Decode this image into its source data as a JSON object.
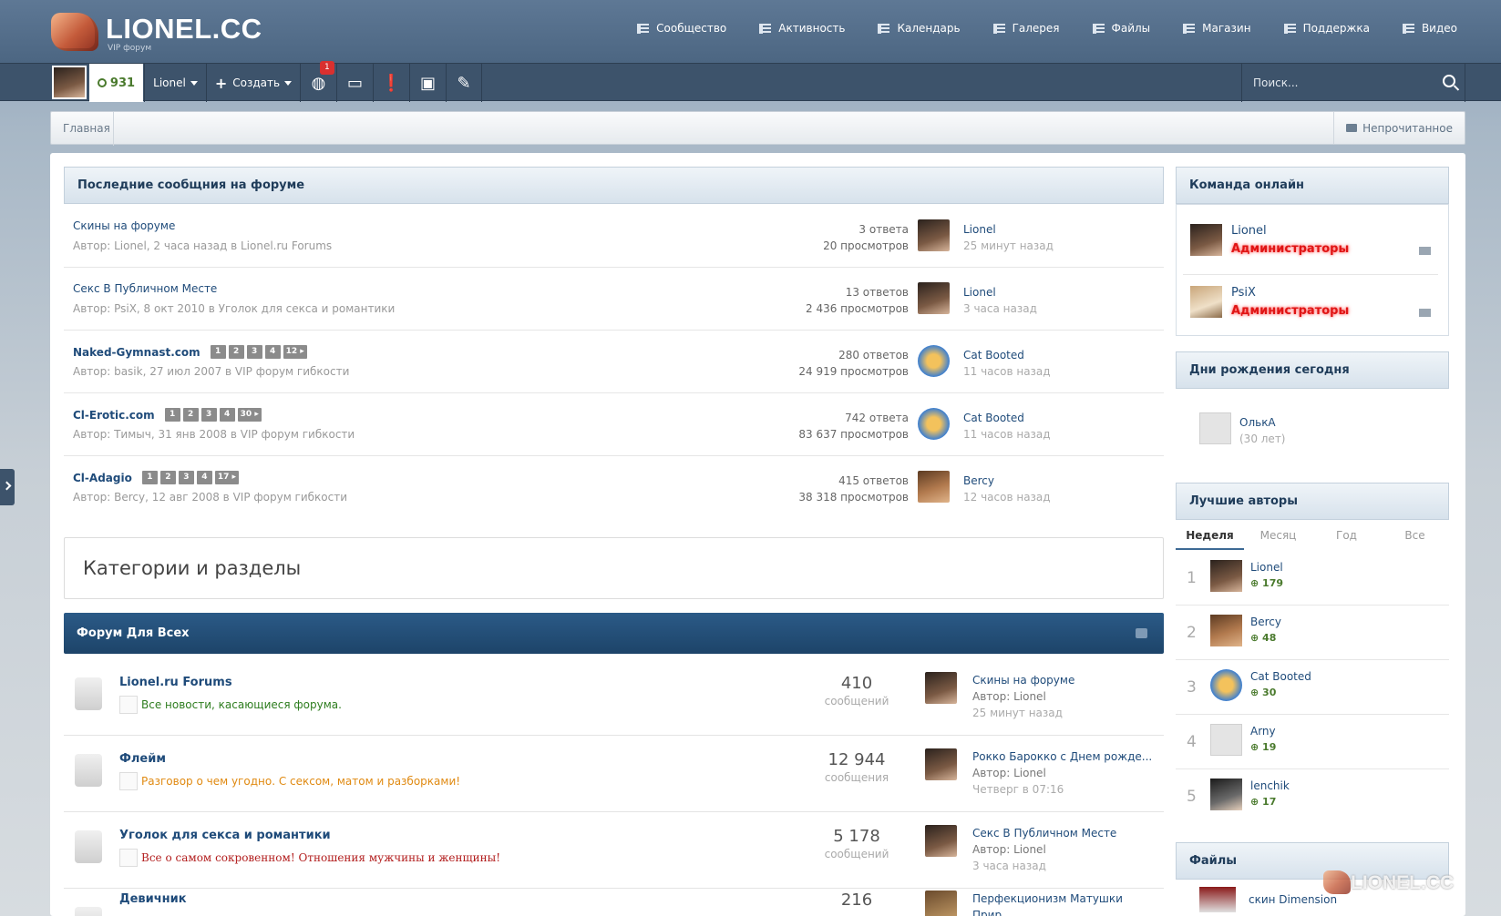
{
  "header": {
    "logo_text": "LIONEL.CC",
    "logo_sub": "VIP форум",
    "nav": [
      {
        "label": "Сообщество",
        "icon": "list-icon"
      },
      {
        "label": "Активность",
        "icon": "list-icon"
      },
      {
        "label": "Календарь",
        "icon": "list-icon"
      },
      {
        "label": "Галерея",
        "icon": "list-icon"
      },
      {
        "label": "Файлы",
        "icon": "list-icon"
      },
      {
        "label": "Магазин",
        "icon": "list-icon"
      },
      {
        "label": "Поддержка",
        "icon": "list-icon"
      },
      {
        "label": "Видео",
        "icon": "list-icon"
      }
    ]
  },
  "userbar": {
    "reputation": "931",
    "username": "Lionel",
    "create_label": "Создать",
    "notification_count": "1",
    "search_placeholder": "Поиск..."
  },
  "breadcrumb": {
    "home": "Главная",
    "unread": "Непрочитанное"
  },
  "recent": {
    "title": "Последние сообщния на форуме",
    "topics": [
      {
        "title": "Скины на форуме",
        "meta": "Автор: Lionel, 2 часа назад в Lionel.ru Forums",
        "replies": "3 ответа",
        "views": "20 просмотров",
        "last_user": "Lionel",
        "last_time": "25 минут назад",
        "pages": []
      },
      {
        "title": "Секс В Публичном Месте",
        "meta": "Автор: PsiX, 8 окт 2010 в Уголок для секса и романтики",
        "replies": "13 ответов",
        "views": "2 436 просмотров",
        "last_user": "Lionel",
        "last_time": "3 часа назад",
        "pages": []
      },
      {
        "title": "Naked-Gymnast.com",
        "meta": "Автор: basik, 27 июл 2007 в VIP форум гибкости",
        "replies": "280 ответов",
        "views": "24 919 просмотров",
        "last_user": "Cat Booted",
        "last_time": "11 часов назад",
        "pages": [
          "1",
          "2",
          "3",
          "4",
          "12 ▸"
        ]
      },
      {
        "title": "Cl-Erotic.com",
        "meta": "Автор: Тимыч, 31 янв 2008 в VIP форум гибкости",
        "replies": "742 ответа",
        "views": "83 637 просмотров",
        "last_user": "Cat Booted",
        "last_time": "11 часов назад",
        "pages": [
          "1",
          "2",
          "3",
          "4",
          "30 ▸"
        ]
      },
      {
        "title": "Cl-Adagio",
        "meta": "Автор: Bercy, 12 авг 2008 в VIP форум гибкости",
        "replies": "415 ответов",
        "views": "38 318 просмотров",
        "last_user": "Bercy",
        "last_time": "12 часов назад",
        "pages": [
          "1",
          "2",
          "3",
          "4",
          "17 ▸"
        ]
      }
    ]
  },
  "categories_title": "Категории и разделы",
  "forum_section": {
    "title": "Форум Для Всех",
    "forums": [
      {
        "title": "Lionel.ru Forums",
        "desc": "Все новости, касающиеся форума.",
        "desc_color": "#2e7d1f",
        "count": "410",
        "count_label": "сообщений",
        "last_title": "Скины на форуме",
        "last_author": "Автор: Lionel",
        "last_time": "25 минут назад"
      },
      {
        "title": "Флейм",
        "desc": "Разговор о чем угодно. С сексом, матом и разборками!",
        "desc_color": "#e08a12",
        "count": "12 944",
        "count_label": "сообщения",
        "last_title": "Рокко Барокко с Днем рожде...",
        "last_author": "Автор: Lionel",
        "last_time": "Четверг в 07:16"
      },
      {
        "title": "Уголок для секса и романтики",
        "desc": "Все о самом сокровенном! Отношения мужчины и женщины!",
        "desc_color": "#b21d1d",
        "count": "5 178",
        "count_label": "сообщений",
        "last_title": "Секс В Публичном Месте",
        "last_author": "Автор: Lionel",
        "last_time": "3 часа назад"
      },
      {
        "title": "Девичник",
        "desc": "",
        "desc_color": "#555",
        "count": "216",
        "count_label": "",
        "last_title": "Перфекционизм Матушки Прир...",
        "last_author": "",
        "last_time": ""
      }
    ]
  },
  "sidebar": {
    "team_title": "Команда онлайн",
    "team": [
      {
        "name": "Lionel",
        "group": "Администраторы"
      },
      {
        "name": "PsiX",
        "group": "Администраторы"
      }
    ],
    "birthday_title": "Дни рождения сегодня",
    "birthday": {
      "name": "ОлькА",
      "age": "(30 лет)"
    },
    "top_title": "Лучшие авторы",
    "tabs": [
      "Неделя",
      "Месяц",
      "Год",
      "Все"
    ],
    "top": [
      {
        "rank": "1",
        "name": "Lionel",
        "points": "179"
      },
      {
        "rank": "2",
        "name": "Bercy",
        "points": "48"
      },
      {
        "rank": "3",
        "name": "Cat Booted",
        "points": "30"
      },
      {
        "rank": "4",
        "name": "Arny",
        "points": "19"
      },
      {
        "rank": "5",
        "name": "lenchik",
        "points": "17"
      }
    ],
    "files_title": "Файлы",
    "file_item": "скин Dimension"
  },
  "watermark": "LIONEL.CC"
}
